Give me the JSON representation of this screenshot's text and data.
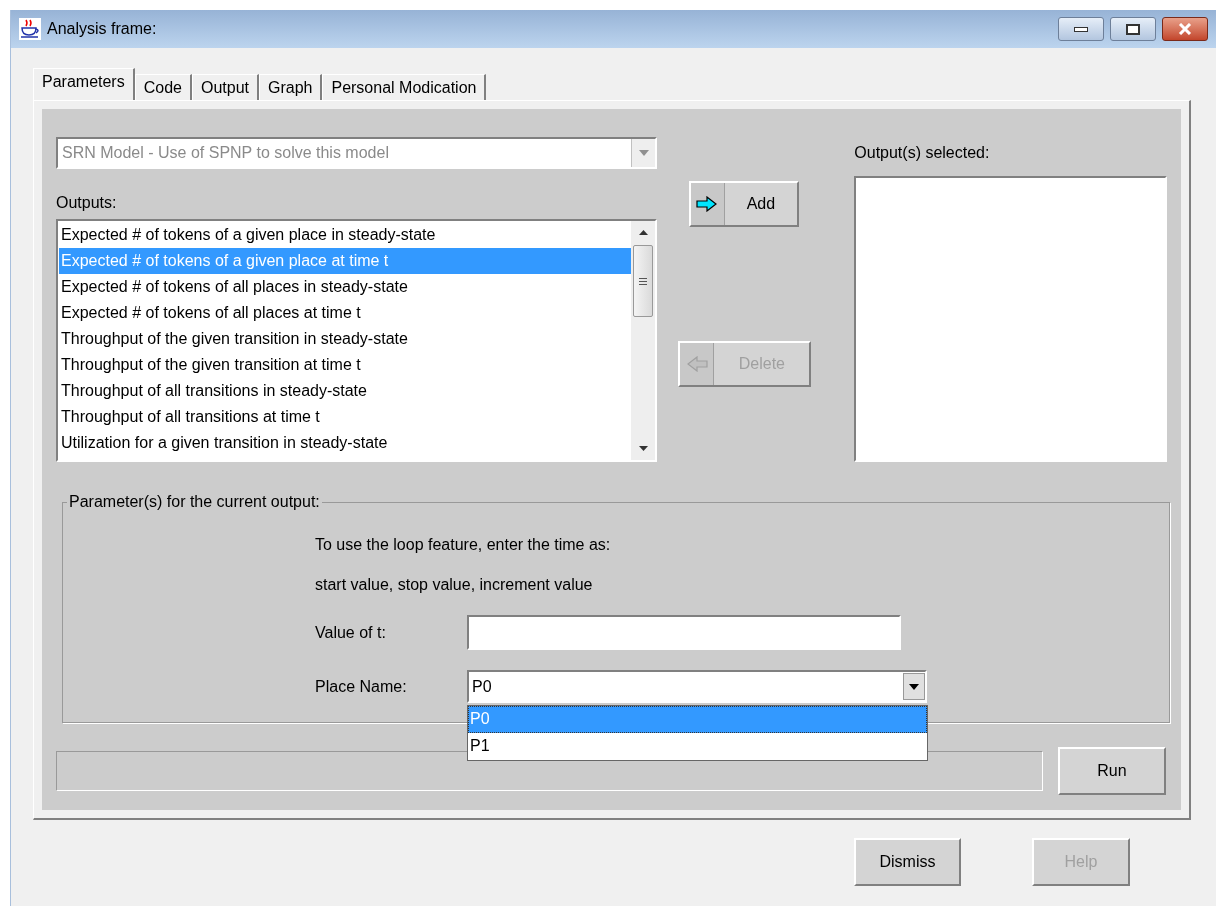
{
  "window": {
    "title": "Analysis frame:"
  },
  "tabs": [
    {
      "label": "Parameters",
      "selected": true
    },
    {
      "label": "Code",
      "selected": false
    },
    {
      "label": "Output",
      "selected": false
    },
    {
      "label": "Graph",
      "selected": false
    },
    {
      "label": "Personal Modication",
      "selected": false
    }
  ],
  "model_select": {
    "value": "SRN Model - Use of SPNP to solve this model",
    "disabled": true
  },
  "outputs": {
    "label": "Outputs:",
    "items": [
      {
        "label": "Expected # of tokens of a given place in steady-state",
        "selected": false
      },
      {
        "label": "Expected # of tokens of a given place at time t",
        "selected": true
      },
      {
        "label": "Expected # of tokens of all places in steady-state",
        "selected": false
      },
      {
        "label": "Expected # of tokens of all places at time t",
        "selected": false
      },
      {
        "label": "Throughput of the given transition in steady-state",
        "selected": false
      },
      {
        "label": "Throughput of the given transition at time t",
        "selected": false
      },
      {
        "label": "Throughput of all transitions in steady-state",
        "selected": false
      },
      {
        "label": "Throughput of all transitions at time t",
        "selected": false
      },
      {
        "label": "Utilization for a given transition in steady-state",
        "selected": false
      }
    ]
  },
  "add_button": {
    "label": "Add",
    "disabled": false
  },
  "delete_button": {
    "label": "Delete",
    "disabled": true
  },
  "selected_outputs": {
    "label": "Output(s) selected:"
  },
  "parameters": {
    "title": "Parameter(s) for the current output:",
    "hints": [
      "To use the loop feature, enter the time as:",
      "start value, stop value, increment value"
    ],
    "time_field": {
      "label": "Value of t:"
    },
    "place": {
      "label": "Place Name:",
      "value": "P0",
      "options": [
        {
          "label": "P0",
          "selected": true
        },
        {
          "label": "P1",
          "selected": false
        }
      ]
    }
  },
  "run_button": {
    "label": "Run",
    "disabled": false
  },
  "dismiss_button": {
    "label": "Dismiss",
    "disabled": false
  },
  "help_button": {
    "label": "Help",
    "disabled": true
  }
}
